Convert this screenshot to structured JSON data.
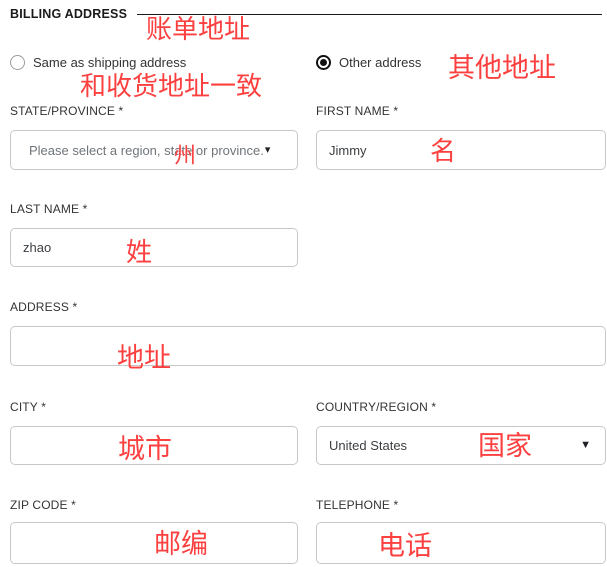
{
  "section": {
    "title": "BILLING ADDRESS"
  },
  "address_choice": {
    "options": [
      {
        "label": "Same as shipping address",
        "selected": false
      },
      {
        "label": "Other address",
        "selected": true
      }
    ]
  },
  "fields": {
    "state_province": {
      "label": "STATE/PROVINCE *",
      "placeholder": "Please select a region, state or province.",
      "value": "",
      "caret": "▾"
    },
    "first_name": {
      "label": "FIRST NAME *",
      "placeholder": "",
      "value": "Jimmy"
    },
    "last_name": {
      "label": "LAST NAME *",
      "placeholder": "",
      "value": "zhao"
    },
    "address": {
      "label": "ADDRESS *",
      "placeholder": "",
      "value": ""
    },
    "city": {
      "label": "CITY *",
      "placeholder": "",
      "value": ""
    },
    "country_region": {
      "label": "COUNTRY/REGION *",
      "placeholder": "",
      "value": "United States",
      "caret": "▼"
    },
    "zip_code": {
      "label": "ZIP CODE *",
      "placeholder": "",
      "value": ""
    },
    "telephone": {
      "label": "TELEPHONE *",
      "placeholder": "",
      "value": ""
    }
  },
  "annotations": {
    "color": "#fc4040",
    "billing_address": "账单地址",
    "same_as_shipping": "和收货地址一致",
    "other_address": "其他地址",
    "state": "州",
    "first_name": "名",
    "last_name": "姓",
    "address": "地址",
    "city": "城市",
    "country": "国家",
    "zip_code": "邮编",
    "telephone": "电话"
  }
}
